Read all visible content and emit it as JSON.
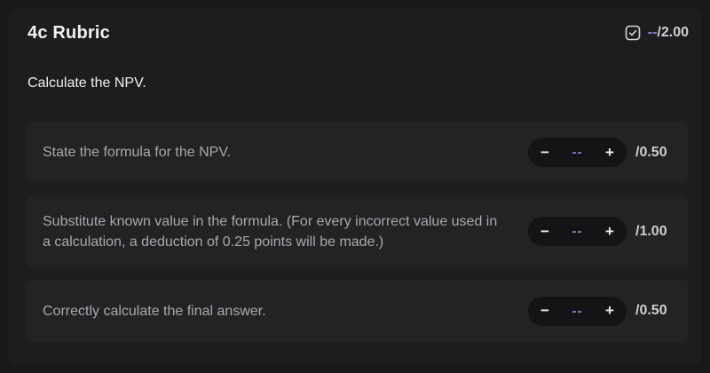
{
  "header": {
    "title": "4c Rubric",
    "score_value": "--",
    "score_total": "/2.00"
  },
  "question": "Calculate the NPV.",
  "criteria": [
    {
      "text": "State the formula for the NPV.",
      "value": "--",
      "minus": "−",
      "plus": "+",
      "max": "/0.50"
    },
    {
      "text": "Substitute known value in the formula. (For every incorrect value used in a calculation, a deduction of 0.25 points will be made.)",
      "value": "--",
      "minus": "−",
      "plus": "+",
      "max": "/1.00"
    },
    {
      "text": "Correctly calculate the final answer.",
      "value": "--",
      "minus": "−",
      "plus": "+",
      "max": "/0.50"
    }
  ],
  "icons": {
    "header_icon": "checkbox-check-icon"
  },
  "colors": {
    "background": "#18181a",
    "panel": "#1d1d1f",
    "criterion_bg": "#232325",
    "stepper_bg": "#141416",
    "accent": "#8b84d8"
  }
}
